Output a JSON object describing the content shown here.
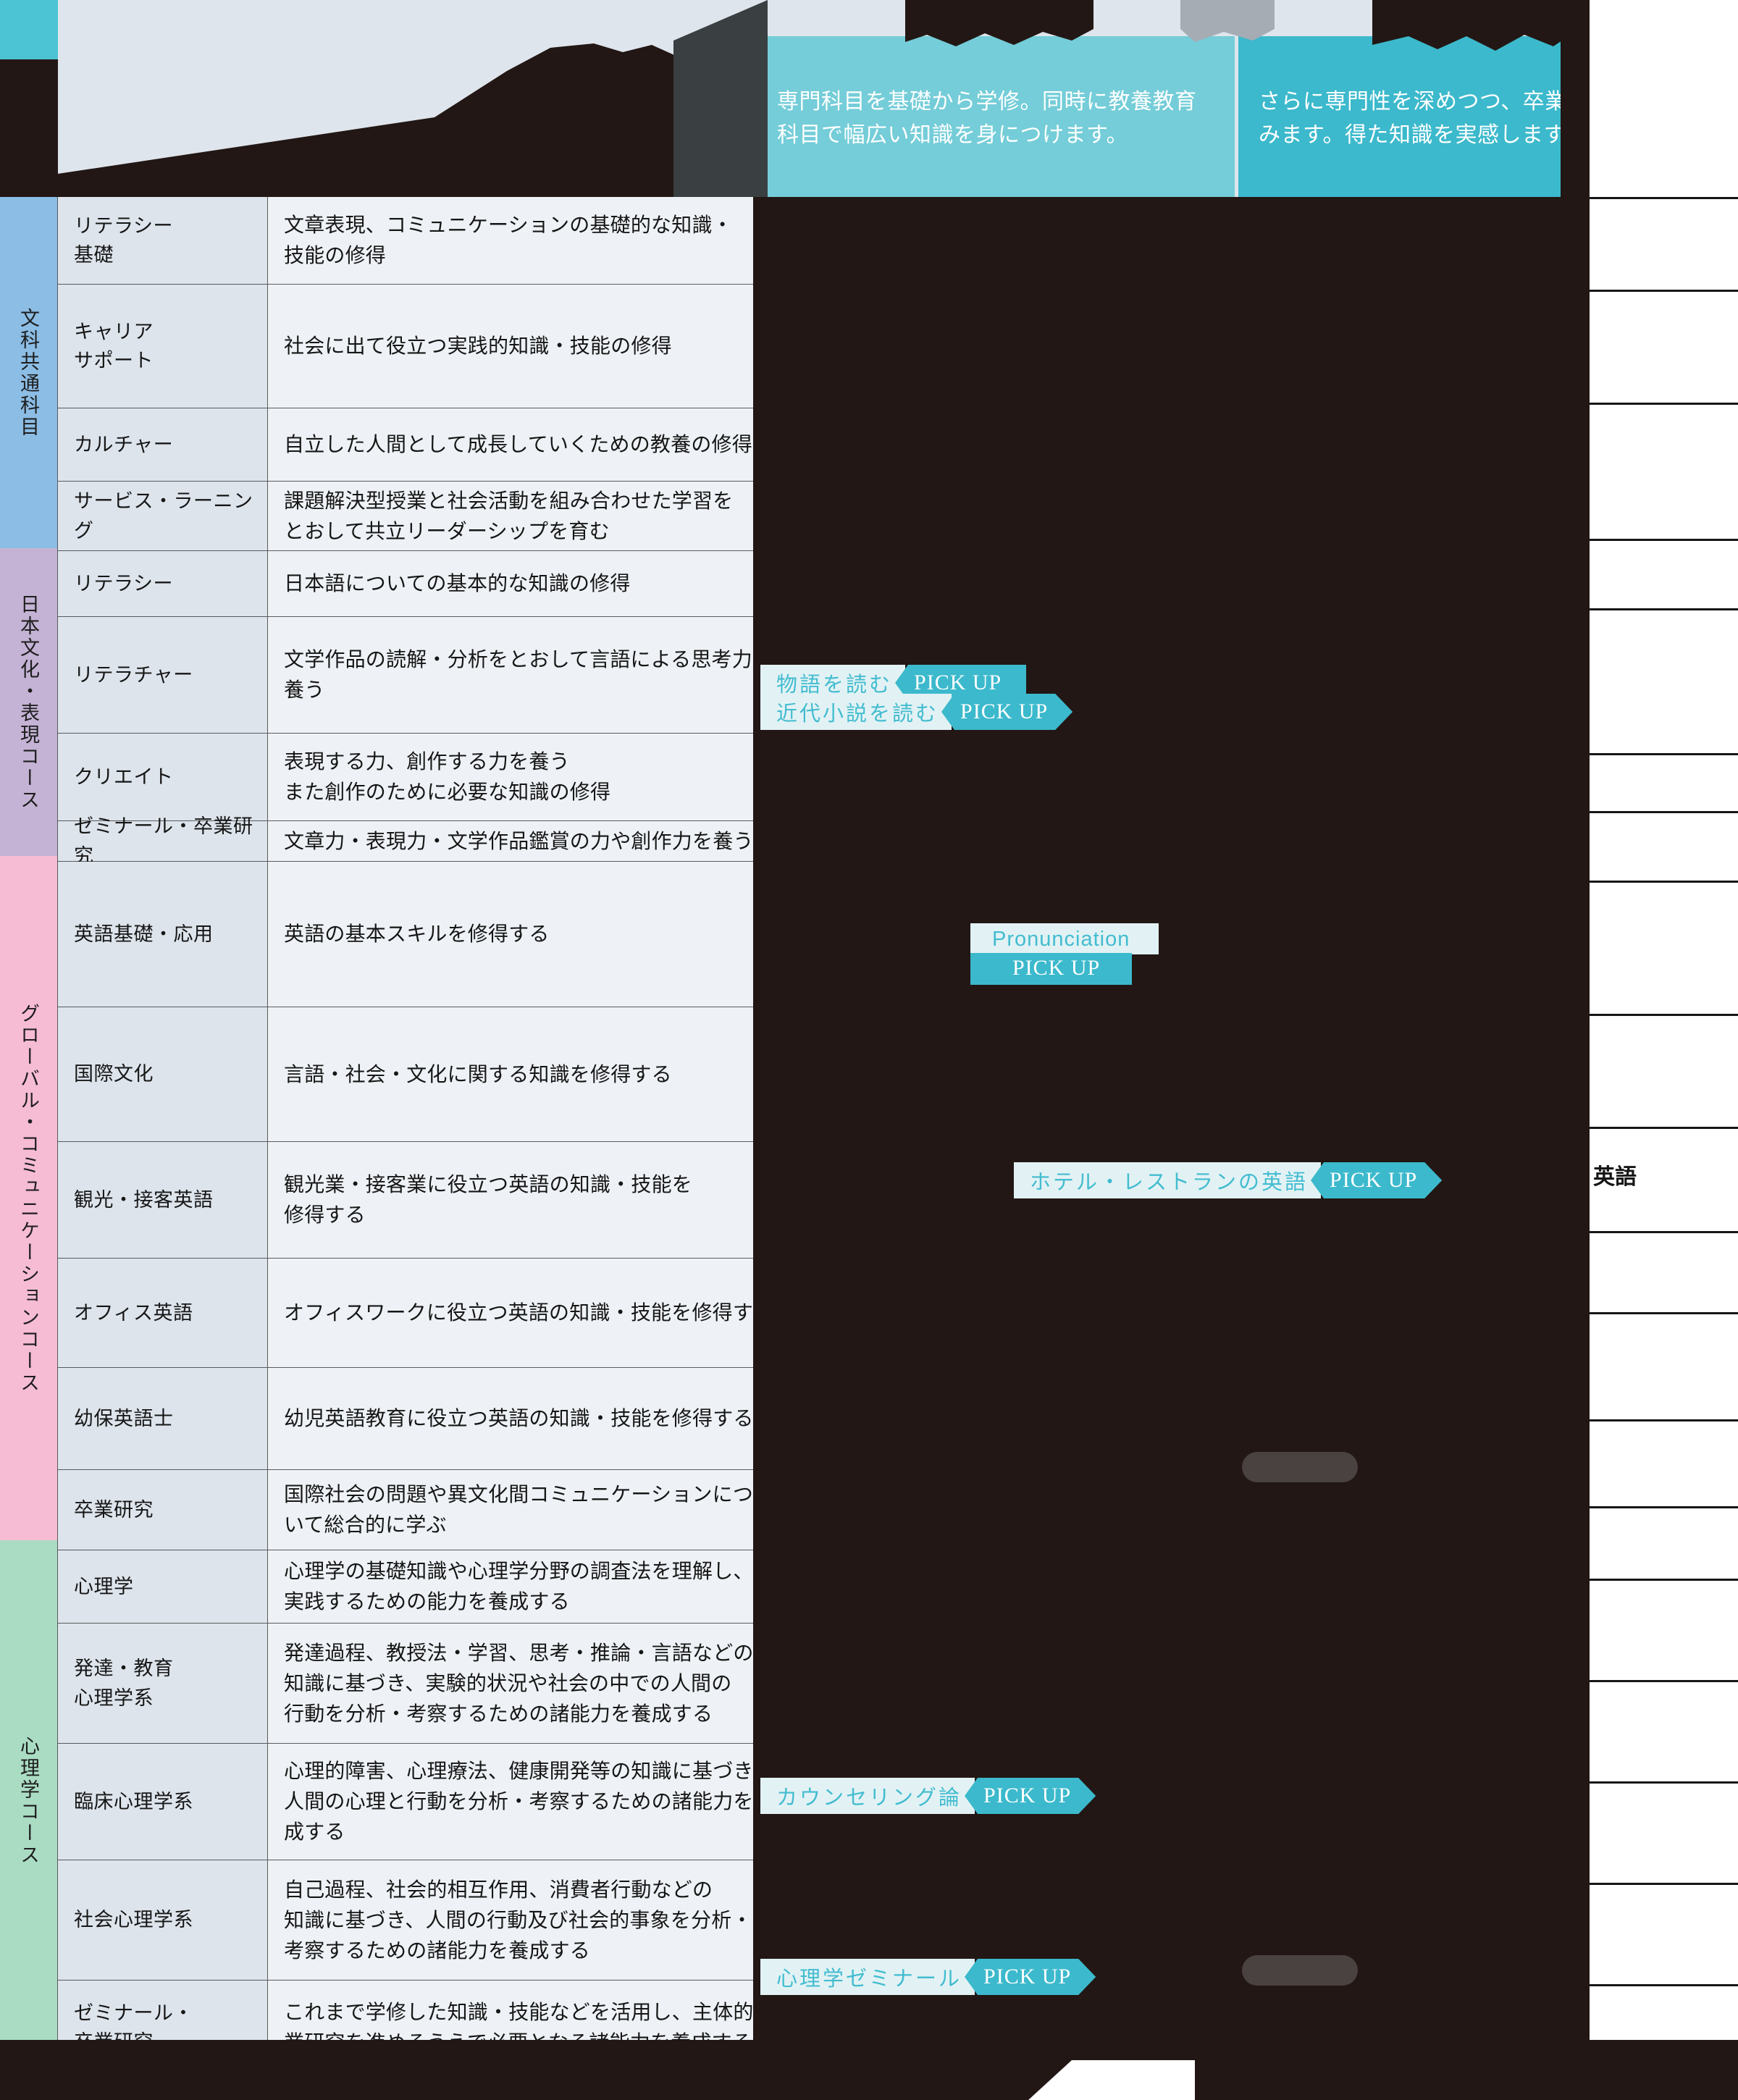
{
  "header": {
    "phase_notes": [
      "専門科目を基礎から学修。同時に教養教育科目で幅広い知識を身につけます。",
      "さらに専門性を深めつつ、卒業課題に取り組みます。得た知識を実感します。"
    ]
  },
  "right_column": {
    "visible_label": "英語"
  },
  "groups": [
    {
      "id": "bunka-kyotsu",
      "label": "文科共通科目",
      "color": "#8cbde4",
      "rows": [
        {
          "subject": "リテラシー\n基礎",
          "desc": "文章表現、コミュニケーションの基礎的な知識・\n技能の修得"
        },
        {
          "subject": "キャリア\nサポート",
          "desc": "社会に出て役立つ実践的知識・技能の修得"
        },
        {
          "subject": "カルチャー",
          "desc": "自立した人間として成長していくための教養の修得"
        },
        {
          "subject": "サービス・ラーニング",
          "desc": "課題解決型授業と社会活動を組み合わせた学習を\nとおして共立リーダーシップを育む"
        }
      ]
    },
    {
      "id": "nihon-bunka",
      "label": "日本文化・表現コース",
      "color": "#c4b3d4",
      "rows": [
        {
          "subject": "リテラシー",
          "desc": "日本語についての基本的な知識の修得"
        },
        {
          "subject": "リテラチャー",
          "desc": "文学作品の読解・分析をとおして言語による思考力を\n養う"
        },
        {
          "subject": "クリエイト",
          "desc": "表現する力、創作する力を養う\nまた創作のために必要な知識の修得"
        },
        {
          "subject": "ゼミナール・卒業研究",
          "desc": "文章力・表現力・文学作品鑑賞の力や創作力を養う"
        }
      ]
    },
    {
      "id": "global-communication",
      "label": "グローバル・コミュニケーションコース",
      "color": "#f6bcd4",
      "rows": [
        {
          "subject": "英語基礎・応用",
          "desc": "英語の基本スキルを修得する"
        },
        {
          "subject": "国際文化",
          "desc": "言語・社会・文化に関する知識を修得する"
        },
        {
          "subject": "観光・接客英語",
          "desc": "観光業・接客業に役立つ英語の知識・技能を\n修得する"
        },
        {
          "subject": "オフィス英語",
          "desc": "オフィスワークに役立つ英語の知識・技能を修得する"
        },
        {
          "subject": "幼保英語士",
          "desc": "幼児英語教育に役立つ英語の知識・技能を修得する"
        },
        {
          "subject": "卒業研究",
          "desc": "国際社会の問題や異文化間コミュニケーションにつ\nいて総合的に学ぶ"
        }
      ]
    },
    {
      "id": "shinrigaku",
      "label": "心理学コース",
      "color": "#aadcc4",
      "rows": [
        {
          "subject": "心理学",
          "desc": "心理学の基礎知識や心理学分野の調査法を理解し、\n実践するための能力を養成する"
        },
        {
          "subject": "発達・教育\n心理学系",
          "desc": "発達過程、教授法・学習、思考・推論・言語などの\n知識に基づき、実験的状況や社会の中での人間の\n行動を分析・考察するための諸能力を養成する"
        },
        {
          "subject": "臨床心理学系",
          "desc": "心理的障害、心理療法、健康開発等の知識に基づき、\n人間の心理と行動を分析・考察するための諸能力を養\n成する"
        },
        {
          "subject": "社会心理学系",
          "desc": "自己過程、社会的相互作用、消費者行動などの\n知識に基づき、人間の行動及び社会的事象を分析・\n考察するための諸能力を養成する"
        },
        {
          "subject": "ゼミナール・\n卒業研究",
          "desc": "これまで学修した知識・技能などを活用し、主体的に卒\n業研究を進めるうえで必要となる諸能力を養成する"
        }
      ]
    }
  ],
  "pickups": [
    {
      "id": "monogatari",
      "name": "物語を読む",
      "tag": "PICK UP"
    },
    {
      "id": "kindai",
      "name": "近代小説を読む",
      "tag": "PICK UP"
    },
    {
      "id": "pronunciation",
      "name": "Pronunciation",
      "tag": "PICK UP"
    },
    {
      "id": "hotel",
      "name": "ホテル・レストランの英語",
      "tag": "PICK UP"
    },
    {
      "id": "counseling",
      "name": "カウンセリング論",
      "tag": "PICK UP"
    },
    {
      "id": "shinri-semi",
      "name": "心理学ゼミナール",
      "tag": "PICK UP"
    }
  ],
  "colors": {
    "accent_teal": "#3cb9cc",
    "accent_teal_light": "#74cdd8",
    "badge_bg": "#e2f2f4",
    "dark": "#221714",
    "row_bg": "#eef2f6",
    "subject_bg": "#dde4ec"
  }
}
